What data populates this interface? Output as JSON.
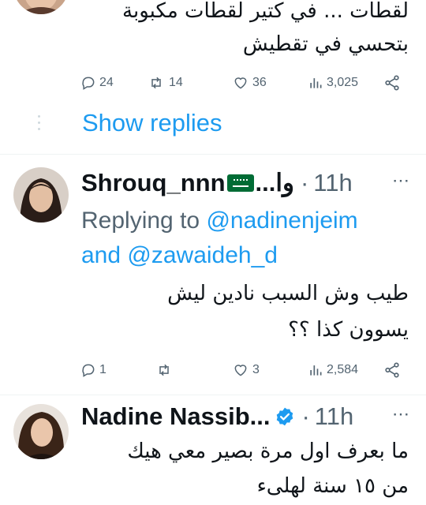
{
  "tweet1": {
    "text_lines": [
      "لقطات ... في كتير لقطات مكبوبة",
      "بتحسي في تقطيش"
    ],
    "replies": "24",
    "retweets": "14",
    "likes": "36",
    "views": "3,025",
    "show_replies": "Show replies"
  },
  "tweet2": {
    "name": "Shrouq_nnn",
    "name_suffix": "وا...",
    "dot": "·",
    "time": "11h",
    "replying_prefix": "Replying to",
    "mention1": "@nadinenjeim",
    "and": "and",
    "mention2": "@zawaideh_d",
    "text_lines": [
      "طيب وش السبب نادين ليش",
      "يسوون كذا ؟؟"
    ],
    "replies": "1",
    "retweets": "",
    "likes": "3",
    "views": "2,584"
  },
  "tweet3": {
    "name": "Nadine Nassib...",
    "dot": "·",
    "time": "11h",
    "text_lines": [
      "ما بعرف اول مرة بصير معي هيك",
      "من ١٥ سنة لهلىء"
    ]
  },
  "colors": {
    "accent": "#1d9bf0",
    "muted": "#536471",
    "text": "#0f1419",
    "flag": "#006c35"
  },
  "icons": {
    "reply": "reply-icon",
    "retweet": "retweet-icon",
    "like": "heart-icon",
    "views": "views-icon",
    "share": "share-icon",
    "more": "more-icon",
    "verified": "verified-badge-icon"
  }
}
